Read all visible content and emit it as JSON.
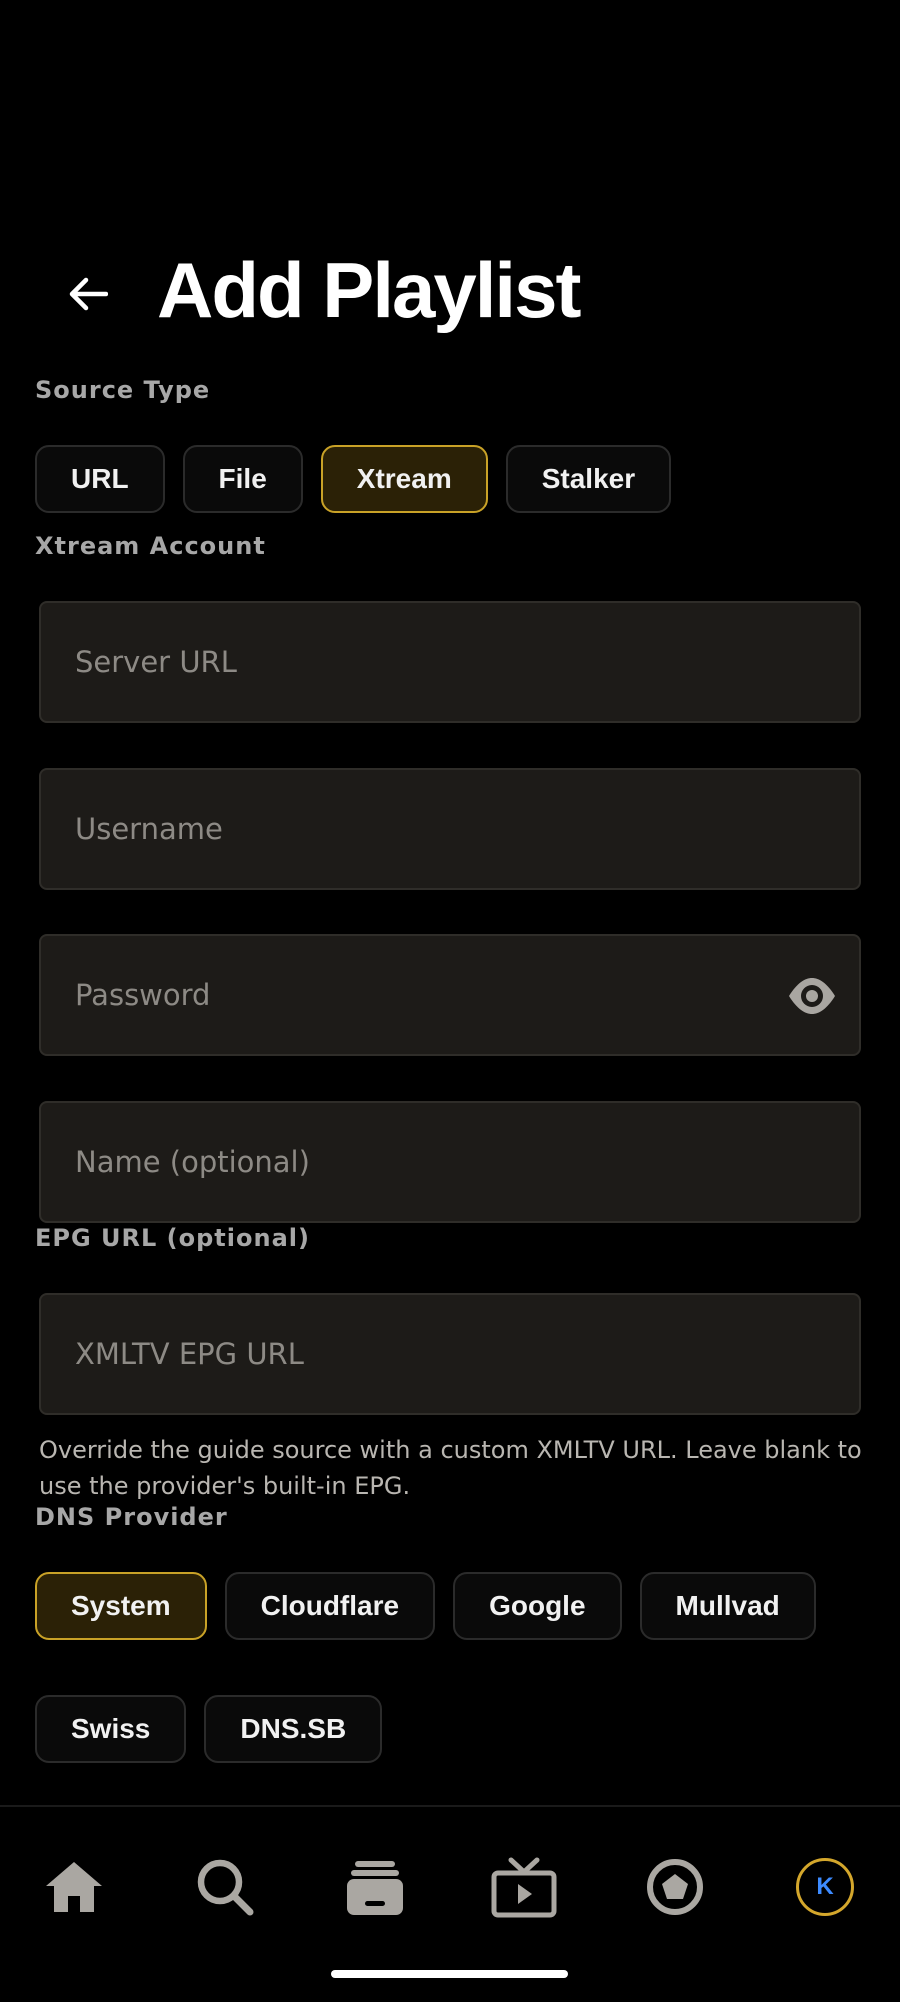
{
  "header": {
    "title": "Add Playlist",
    "back_icon": "arrow-left-icon"
  },
  "source_type": {
    "label": "Source Type",
    "options": [
      "URL",
      "File",
      "Xtream",
      "Stalker"
    ],
    "selected": "Xtream"
  },
  "xtream": {
    "label": "Xtream Account",
    "server_url": {
      "placeholder": "Server URL",
      "value": ""
    },
    "username": {
      "placeholder": "Username",
      "value": ""
    },
    "password": {
      "placeholder": "Password",
      "value": "",
      "toggle_icon": "eye-icon"
    },
    "name": {
      "placeholder": "Name (optional)",
      "value": ""
    }
  },
  "epg": {
    "label": "EPG URL (optional)",
    "placeholder": "XMLTV EPG URL",
    "value": "",
    "help": "Override the guide source with a custom XMLTV URL. Leave blank to use the provider's built-in EPG."
  },
  "dns": {
    "label": "DNS Provider",
    "options": [
      "System",
      "Cloudflare",
      "Google",
      "Mullvad",
      "Swiss",
      "DNS.SB"
    ],
    "selected": "System"
  },
  "bottom_nav": {
    "items": [
      "home-icon",
      "search-icon",
      "library-icon",
      "live-tv-icon",
      "discover-icon",
      "profile-avatar"
    ],
    "avatar_initial": "K"
  },
  "colors": {
    "accent": "#c9a227",
    "accent_bg": "#2b2106",
    "field_bg": "#1d1b18",
    "avatar_text": "#3d8bff"
  }
}
